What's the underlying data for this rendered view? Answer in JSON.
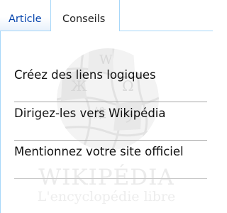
{
  "tabs": [
    {
      "label": "Article",
      "state": "inactive"
    },
    {
      "label": "Conseils",
      "state": "active"
    }
  ],
  "tips": [
    "Créez des liens logiques",
    "Dirigez-les vers Wikipédia",
    "Mentionnez votre site officiel"
  ],
  "watermark": {
    "title": "WIKIPÉDIA",
    "subtitle": "L'encyclopédie libre"
  },
  "colors": {
    "link": "#0645ad",
    "tab_border": "#a7d7f9",
    "watermark": "#e9e9e9"
  }
}
